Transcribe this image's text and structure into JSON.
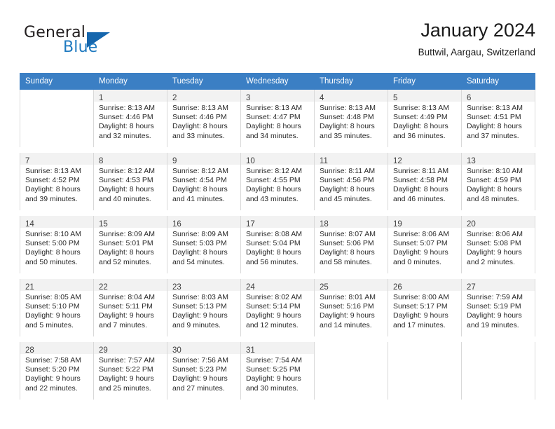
{
  "brand": {
    "name_part1": "General",
    "name_part2": "Blue",
    "triangle_color": "#1566ad",
    "blue_color": "#1f7ac0"
  },
  "header": {
    "title": "January 2024",
    "subtitle": "Buttwil, Aargau, Switzerland",
    "header_bg_color": "#3b7fc4"
  },
  "weekday_headers": [
    "Sunday",
    "Monday",
    "Tuesday",
    "Wednesday",
    "Thursday",
    "Friday",
    "Saturday"
  ],
  "labels": {
    "sunrise_prefix": "Sunrise:",
    "sunset_prefix": "Sunset:",
    "daylight_prefix": "Daylight:"
  },
  "weeks": [
    [
      {
        "day": "",
        "line1": "",
        "line2": "",
        "line3": "",
        "line4": "",
        "blank": true
      },
      {
        "day": "1",
        "line1": "Sunrise: 8:13 AM",
        "line2": "Sunset: 4:46 PM",
        "line3": "Daylight: 8 hours",
        "line4": "and 32 minutes."
      },
      {
        "day": "2",
        "line1": "Sunrise: 8:13 AM",
        "line2": "Sunset: 4:46 PM",
        "line3": "Daylight: 8 hours",
        "line4": "and 33 minutes."
      },
      {
        "day": "3",
        "line1": "Sunrise: 8:13 AM",
        "line2": "Sunset: 4:47 PM",
        "line3": "Daylight: 8 hours",
        "line4": "and 34 minutes."
      },
      {
        "day": "4",
        "line1": "Sunrise: 8:13 AM",
        "line2": "Sunset: 4:48 PM",
        "line3": "Daylight: 8 hours",
        "line4": "and 35 minutes."
      },
      {
        "day": "5",
        "line1": "Sunrise: 8:13 AM",
        "line2": "Sunset: 4:49 PM",
        "line3": "Daylight: 8 hours",
        "line4": "and 36 minutes."
      },
      {
        "day": "6",
        "line1": "Sunrise: 8:13 AM",
        "line2": "Sunset: 4:51 PM",
        "line3": "Daylight: 8 hours",
        "line4": "and 37 minutes."
      }
    ],
    [
      {
        "day": "7",
        "line1": "Sunrise: 8:13 AM",
        "line2": "Sunset: 4:52 PM",
        "line3": "Daylight: 8 hours",
        "line4": "and 39 minutes."
      },
      {
        "day": "8",
        "line1": "Sunrise: 8:12 AM",
        "line2": "Sunset: 4:53 PM",
        "line3": "Daylight: 8 hours",
        "line4": "and 40 minutes."
      },
      {
        "day": "9",
        "line1": "Sunrise: 8:12 AM",
        "line2": "Sunset: 4:54 PM",
        "line3": "Daylight: 8 hours",
        "line4": "and 41 minutes."
      },
      {
        "day": "10",
        "line1": "Sunrise: 8:12 AM",
        "line2": "Sunset: 4:55 PM",
        "line3": "Daylight: 8 hours",
        "line4": "and 43 minutes."
      },
      {
        "day": "11",
        "line1": "Sunrise: 8:11 AM",
        "line2": "Sunset: 4:56 PM",
        "line3": "Daylight: 8 hours",
        "line4": "and 45 minutes."
      },
      {
        "day": "12",
        "line1": "Sunrise: 8:11 AM",
        "line2": "Sunset: 4:58 PM",
        "line3": "Daylight: 8 hours",
        "line4": "and 46 minutes."
      },
      {
        "day": "13",
        "line1": "Sunrise: 8:10 AM",
        "line2": "Sunset: 4:59 PM",
        "line3": "Daylight: 8 hours",
        "line4": "and 48 minutes."
      }
    ],
    [
      {
        "day": "14",
        "line1": "Sunrise: 8:10 AM",
        "line2": "Sunset: 5:00 PM",
        "line3": "Daylight: 8 hours",
        "line4": "and 50 minutes."
      },
      {
        "day": "15",
        "line1": "Sunrise: 8:09 AM",
        "line2": "Sunset: 5:01 PM",
        "line3": "Daylight: 8 hours",
        "line4": "and 52 minutes."
      },
      {
        "day": "16",
        "line1": "Sunrise: 8:09 AM",
        "line2": "Sunset: 5:03 PM",
        "line3": "Daylight: 8 hours",
        "line4": "and 54 minutes."
      },
      {
        "day": "17",
        "line1": "Sunrise: 8:08 AM",
        "line2": "Sunset: 5:04 PM",
        "line3": "Daylight: 8 hours",
        "line4": "and 56 minutes."
      },
      {
        "day": "18",
        "line1": "Sunrise: 8:07 AM",
        "line2": "Sunset: 5:06 PM",
        "line3": "Daylight: 8 hours",
        "line4": "and 58 minutes."
      },
      {
        "day": "19",
        "line1": "Sunrise: 8:06 AM",
        "line2": "Sunset: 5:07 PM",
        "line3": "Daylight: 9 hours",
        "line4": "and 0 minutes."
      },
      {
        "day": "20",
        "line1": "Sunrise: 8:06 AM",
        "line2": "Sunset: 5:08 PM",
        "line3": "Daylight: 9 hours",
        "line4": "and 2 minutes."
      }
    ],
    [
      {
        "day": "21",
        "line1": "Sunrise: 8:05 AM",
        "line2": "Sunset: 5:10 PM",
        "line3": "Daylight: 9 hours",
        "line4": "and 5 minutes."
      },
      {
        "day": "22",
        "line1": "Sunrise: 8:04 AM",
        "line2": "Sunset: 5:11 PM",
        "line3": "Daylight: 9 hours",
        "line4": "and 7 minutes."
      },
      {
        "day": "23",
        "line1": "Sunrise: 8:03 AM",
        "line2": "Sunset: 5:13 PM",
        "line3": "Daylight: 9 hours",
        "line4": "and 9 minutes."
      },
      {
        "day": "24",
        "line1": "Sunrise: 8:02 AM",
        "line2": "Sunset: 5:14 PM",
        "line3": "Daylight: 9 hours",
        "line4": "and 12 minutes."
      },
      {
        "day": "25",
        "line1": "Sunrise: 8:01 AM",
        "line2": "Sunset: 5:16 PM",
        "line3": "Daylight: 9 hours",
        "line4": "and 14 minutes."
      },
      {
        "day": "26",
        "line1": "Sunrise: 8:00 AM",
        "line2": "Sunset: 5:17 PM",
        "line3": "Daylight: 9 hours",
        "line4": "and 17 minutes."
      },
      {
        "day": "27",
        "line1": "Sunrise: 7:59 AM",
        "line2": "Sunset: 5:19 PM",
        "line3": "Daylight: 9 hours",
        "line4": "and 19 minutes."
      }
    ],
    [
      {
        "day": "28",
        "line1": "Sunrise: 7:58 AM",
        "line2": "Sunset: 5:20 PM",
        "line3": "Daylight: 9 hours",
        "line4": "and 22 minutes."
      },
      {
        "day": "29",
        "line1": "Sunrise: 7:57 AM",
        "line2": "Sunset: 5:22 PM",
        "line3": "Daylight: 9 hours",
        "line4": "and 25 minutes."
      },
      {
        "day": "30",
        "line1": "Sunrise: 7:56 AM",
        "line2": "Sunset: 5:23 PM",
        "line3": "Daylight: 9 hours",
        "line4": "and 27 minutes."
      },
      {
        "day": "31",
        "line1": "Sunrise: 7:54 AM",
        "line2": "Sunset: 5:25 PM",
        "line3": "Daylight: 9 hours",
        "line4": "and 30 minutes."
      },
      {
        "day": "",
        "line1": "",
        "line2": "",
        "line3": "",
        "line4": "",
        "blank": true
      },
      {
        "day": "",
        "line1": "",
        "line2": "",
        "line3": "",
        "line4": "",
        "blank": true
      },
      {
        "day": "",
        "line1": "",
        "line2": "",
        "line3": "",
        "line4": "",
        "blank": true
      }
    ]
  ]
}
